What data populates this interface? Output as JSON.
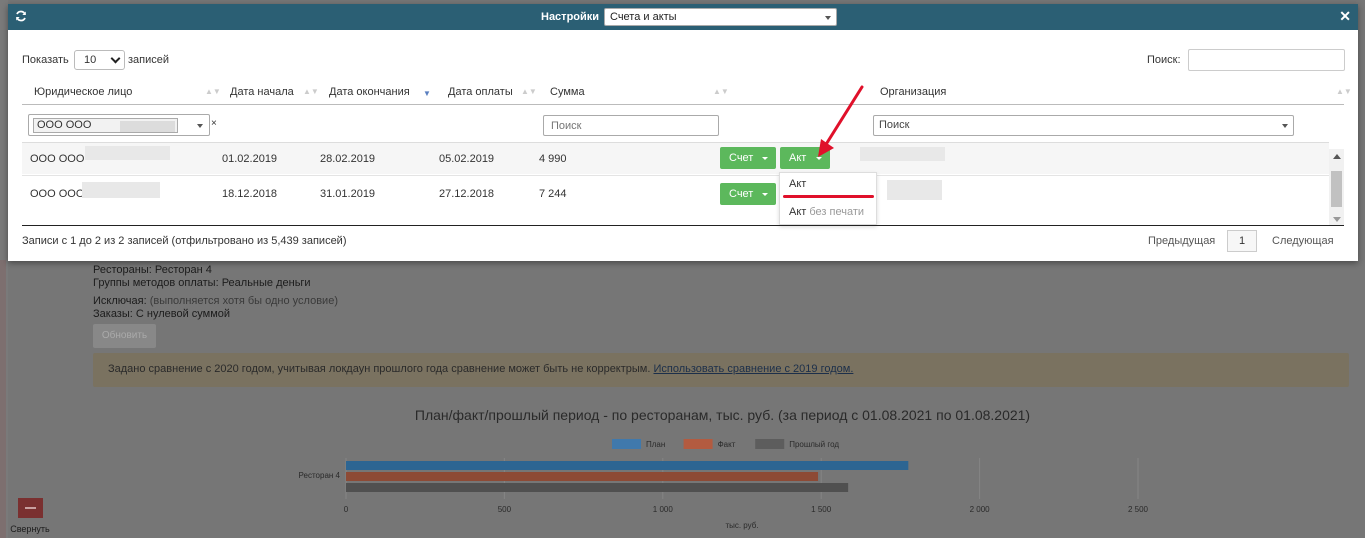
{
  "modal": {
    "title": "Настройки",
    "doc_type_select": "Счета и акты",
    "length_label": "Показать",
    "length_value": "10",
    "length_suffix": "записей",
    "search_label": "Поиск:",
    "search_value": "",
    "columns": [
      "Юридическое лицо",
      "Дата начала",
      "Дата окончания",
      "Дата оплаты",
      "Сумма",
      "Организация"
    ],
    "filters": {
      "entity_tag": "ООО ООО",
      "entity_clear": "×",
      "sum_placeholder": "Поиск",
      "org_placeholder": "Поиск"
    },
    "rows": [
      {
        "entity": "ООО ООО",
        "start": "01.02.2019",
        "end": "28.02.2019",
        "paid": "05.02.2019",
        "sum": "4 990",
        "invoice_btn": "Счет",
        "act_btn": "Акт"
      },
      {
        "entity": "ООО ООО",
        "start": "18.12.2018",
        "end": "31.01.2019",
        "paid": "27.12.2018",
        "sum": "7 244",
        "invoice_btn": "Счет"
      }
    ],
    "dropdown": {
      "item1": "Акт",
      "item2_main": "Акт",
      "item2_muted": "без печати"
    },
    "footer": {
      "info": "Записи с 1 до 2 из 2 записей (отфильтровано из 5,439 записей)",
      "prev": "Предыдущая",
      "page": "1",
      "next": "Следующая"
    }
  },
  "background": {
    "lines": [
      {
        "label": "Рестораны: ",
        "value": "Ресторан 4"
      },
      {
        "label": "Группы методов оплаты: ",
        "value": "Реальные деньги"
      },
      {
        "label": "Исключая: ",
        "muted": "(выполняется хотя бы одно условие)"
      },
      {
        "label": "Заказы: ",
        "value": "С нулевой суммой"
      }
    ],
    "refresh_button": "Обновить",
    "alert_text": "Задано сравнение с 2020 годом, учитывая локдаун прошлого года сравнение может быть не корректрым. ",
    "alert_link": "Использовать сравнение с 2019 годом.",
    "collapse_label": "Свернуть"
  },
  "chart_data": {
    "type": "bar",
    "orientation": "horizontal",
    "title": "План/факт/прошлый период - по ресторанам, тыс. руб. (за период с 01.08.2021 по 01.08.2021)",
    "categories": [
      "Ресторан 4"
    ],
    "series": [
      {
        "name": "План",
        "values": [
          1775
        ],
        "color": "#2f7bbf"
      },
      {
        "name": "Факт",
        "values": [
          1490
        ],
        "color": "#c8532f"
      },
      {
        "name": "Прошлый год",
        "values": [
          1585
        ],
        "color": "#555555"
      }
    ],
    "xlabel": "тыс. руб.",
    "xticks": [
      "0",
      "500",
      "1 000",
      "1 500",
      "2 000",
      "2 500"
    ],
    "xlim": [
      0,
      2500
    ],
    "legend": "top-center"
  }
}
